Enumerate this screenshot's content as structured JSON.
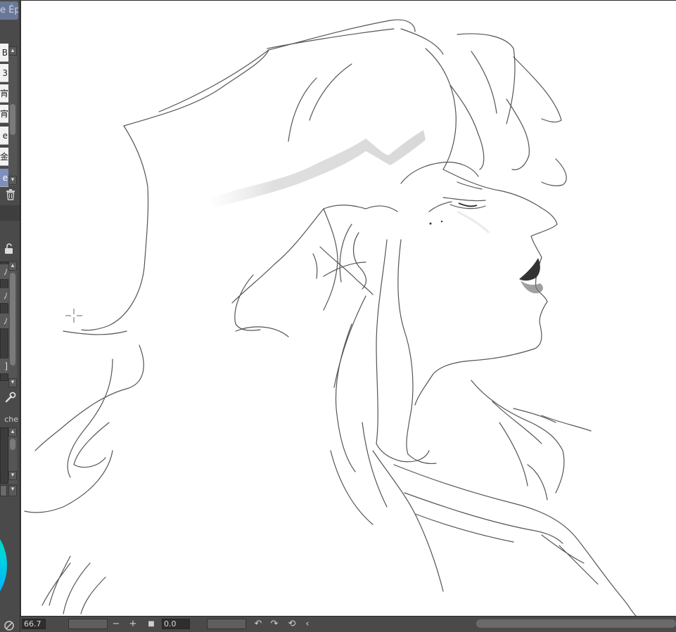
{
  "tab": {
    "label": "e Ép"
  },
  "layer_list": {
    "rows": [
      "B",
      "3",
      "宵",
      "宵",
      "e",
      "金",
      "e"
    ],
    "selected_index": 6
  },
  "tool_panel": {
    "label": "che"
  },
  "colors": {
    "accent": "#7d8fba",
    "canvas_bg": "#ffffff",
    "panel_bg": "#4a4a4a",
    "stroke": "#555555"
  },
  "status_bar": {
    "zoom_value": "66.7",
    "minus_symbol": "−",
    "plus_symbol": "+",
    "stop_symbol": "■",
    "rotation_value": "0.0",
    "rotate_left_symbol": "↶",
    "rotate_right_symbol": "↷",
    "reset_rotation_symbol": "⟲",
    "prev_symbol": "‹"
  },
  "icons": {
    "delete": "trash-icon",
    "lock": "lock-icon",
    "wrench": "wrench-icon",
    "cursor": "crosshair-cursor-icon"
  }
}
